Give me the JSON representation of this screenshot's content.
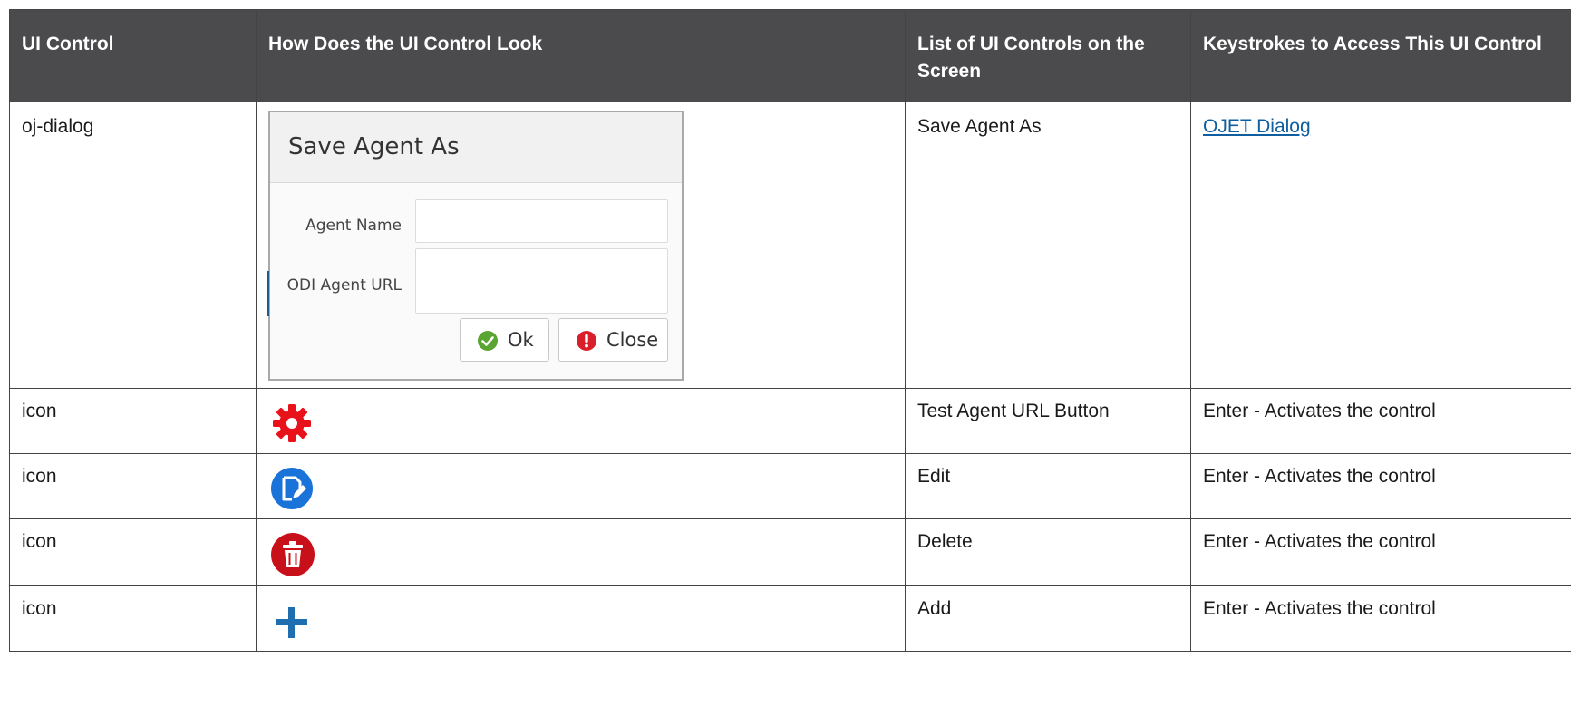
{
  "headers": {
    "col1": "UI Control",
    "col2": "How Does the UI Control Look",
    "col3": "List of UI Controls on the Screen",
    "col4": "Keystrokes to Access This UI Control"
  },
  "rows": [
    {
      "control": "oj-dialog",
      "list": "Save Agent As",
      "keystroke": "OJET Dialog",
      "dialog": {
        "title": "Save Agent As",
        "agent_name_label": "Agent Name",
        "agent_name_value": "",
        "odi_url_label": "ODI Agent URL",
        "odi_url_value": "",
        "ok_label": "Ok",
        "close_label": "Close"
      }
    },
    {
      "control": "icon",
      "icon": "gear-icon",
      "icon_color": "#e8121b",
      "list": "Test Agent URL Button",
      "keystroke": "Enter - Activates the control"
    },
    {
      "control": "icon",
      "icon": "edit-icon",
      "icon_color": "#1a73d8",
      "list": "Edit",
      "keystroke": "Enter - Activates the control"
    },
    {
      "control": "icon",
      "icon": "trash-icon",
      "icon_color": "#c8101a",
      "list": "Delete",
      "keystroke": "Enter - Activates the control"
    },
    {
      "control": "icon",
      "icon": "plus-icon",
      "icon_color": "#1f6fb0",
      "list": "Add",
      "keystroke": "Enter - Activates the control"
    }
  ]
}
